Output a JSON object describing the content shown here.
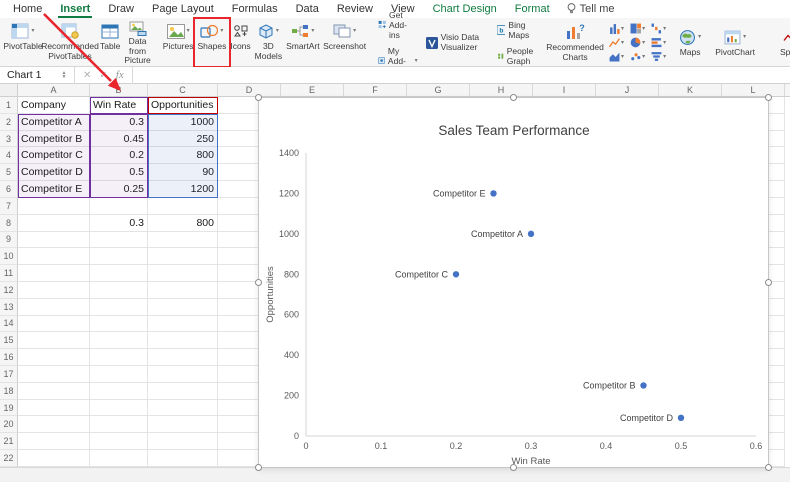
{
  "tabs": [
    {
      "label": "Home"
    },
    {
      "label": "Insert",
      "active": true
    },
    {
      "label": "Draw"
    },
    {
      "label": "Page Layout"
    },
    {
      "label": "Formulas"
    },
    {
      "label": "Data"
    },
    {
      "label": "Review"
    },
    {
      "label": "View"
    },
    {
      "label": "Chart Design",
      "contextual": true
    },
    {
      "label": "Format",
      "contextual": true
    }
  ],
  "tell_me": "Tell me",
  "ribbon": {
    "pivot_group": [
      {
        "label": "PivotTable"
      },
      {
        "label": "Recommended PivotTables"
      },
      {
        "label": "Table"
      },
      {
        "label": "Data from Picture"
      }
    ],
    "illustrations": [
      {
        "label": "Pictures"
      },
      {
        "label": "Shapes",
        "highlighted": true
      },
      {
        "label": "Icons"
      },
      {
        "label": "3D Models"
      },
      {
        "label": "SmartArt"
      },
      {
        "label": "Screenshot"
      }
    ],
    "addins": {
      "get_addins": "Get Add-ins",
      "my_addins": "My Add-ins",
      "visio": "Visio Data Visualizer",
      "bing_maps": "Bing Maps",
      "people_graph": "People Graph"
    },
    "charts_group": {
      "recommended": "Recommended Charts",
      "maps": "Maps",
      "pivotchart": "PivotChart",
      "sparkline": "Spark"
    },
    "chart_type_icons": [
      "column-chart-icon",
      "treemap-chart-icon",
      "waterfall-chart-icon",
      "line-chart-icon",
      "pie-chart-icon",
      "bar-chart-icon",
      "area-chart-icon",
      "scatter-chart-icon",
      "funnel-chart-icon"
    ]
  },
  "formula_bar": {
    "name_box": "Chart 1",
    "cancel": "✕",
    "enter": "✓",
    "fx": "fx",
    "value": ""
  },
  "sheet": {
    "col_headers": [
      "A",
      "B",
      "C",
      "D",
      "E",
      "F",
      "G",
      "H",
      "I",
      "J",
      "K",
      "L"
    ],
    "row_count": 22,
    "cells": {
      "A1": "Company",
      "B1": "Win Rate",
      "C1": "Opportunities",
      "A2": "Competitor A",
      "B2": "0.3",
      "C2": "1000",
      "A3": "Competitor B",
      "B3": "0.45",
      "C3": "250",
      "A4": "Competitor C",
      "B4": "0.2",
      "C4": "800",
      "A5": "Competitor D",
      "B5": "0.5",
      "C5": "90",
      "A6": "Competitor E",
      "B6": "0.25",
      "C6": "1200",
      "B8": "0.3",
      "C8": "800"
    }
  },
  "chart_data": {
    "type": "scatter",
    "title": "Sales Team Performance",
    "xlabel": "Win Rate",
    "ylabel": "Opportunities",
    "xlim": [
      0,
      0.6
    ],
    "ylim": [
      0,
      1400
    ],
    "xticks": [
      "0",
      "0.1",
      "0.2",
      "0.3",
      "0.4",
      "0.5",
      "0.6"
    ],
    "yticks": [
      "0",
      "200",
      "400",
      "600",
      "800",
      "1000",
      "1200",
      "1400"
    ],
    "grid": false,
    "legend": false,
    "series": [
      {
        "name": "Opportunities",
        "points": [
          {
            "label": "Competitor A",
            "x": 0.3,
            "y": 1000
          },
          {
            "label": "Competitor B",
            "x": 0.45,
            "y": 250
          },
          {
            "label": "Competitor C",
            "x": 0.2,
            "y": 800
          },
          {
            "label": "Competitor D",
            "x": 0.5,
            "y": 90
          },
          {
            "label": "Competitor E",
            "x": 0.25,
            "y": 1200
          }
        ]
      }
    ]
  },
  "colors": {
    "excel_green": "#107C41",
    "annotation_red": "#E8262C",
    "point": "#4472C4",
    "highlight_purple": "#7030A0",
    "highlight_blue": "#4472C4",
    "highlight_red": "#C00000"
  }
}
